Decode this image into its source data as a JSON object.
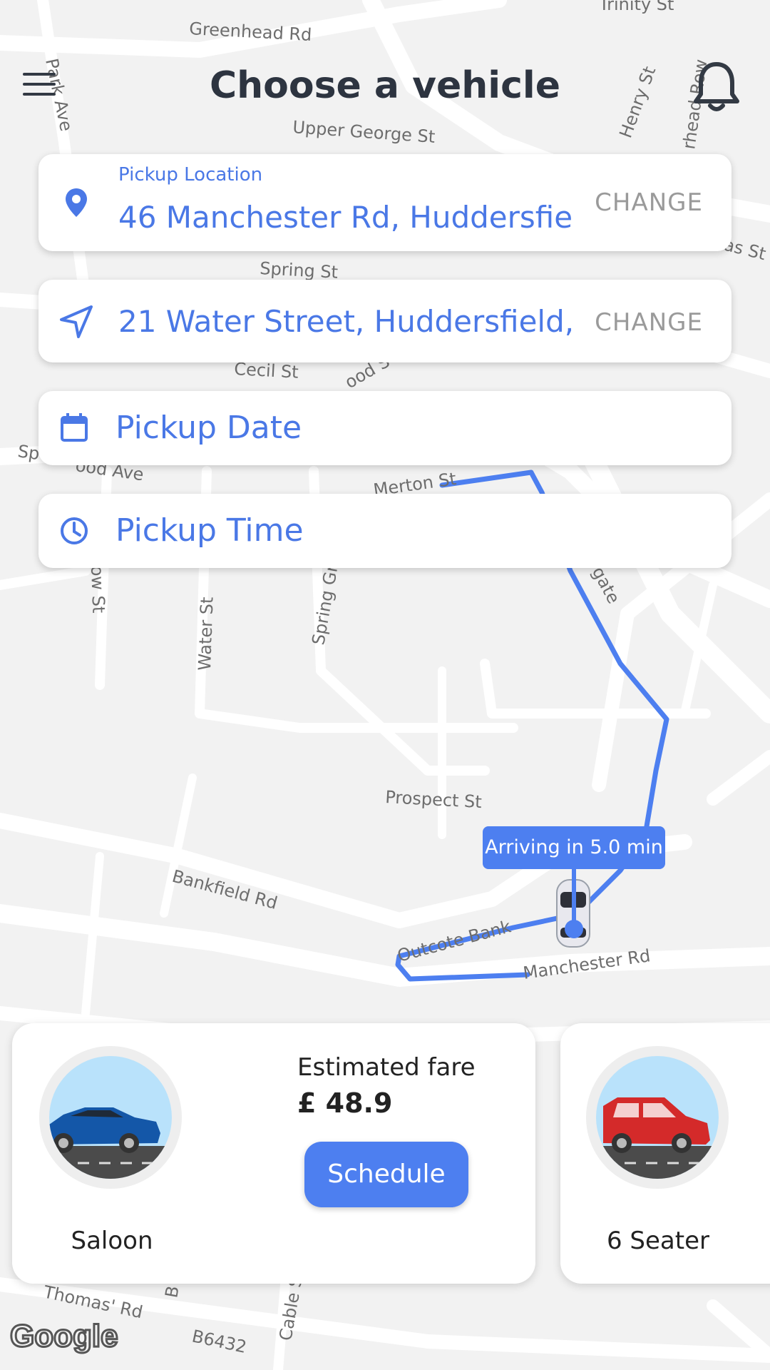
{
  "header": {
    "title": "Choose a vehicle",
    "menu_icon": "hamburger-menu-icon",
    "bell_icon": "bell-icon"
  },
  "pickup": {
    "label": "Pickup Location",
    "value": "46 Manchester Rd, Huddersfie",
    "change_label": "CHANGE"
  },
  "destination": {
    "value": "21 Water Street, Huddersfield,",
    "change_label": "CHANGE"
  },
  "pickup_date": {
    "placeholder": "Pickup Date"
  },
  "pickup_time": {
    "placeholder": "Pickup Time"
  },
  "map": {
    "streets": [
      "Greenhead Rd",
      "Trinity St",
      "Park Ave",
      "Upper George St",
      "Henry St",
      "rhead Row",
      "Spring St",
      "as St",
      "Cecil St",
      "ood S",
      "Sp",
      "ood Ave",
      "Merton St",
      "ow St",
      "Water St",
      "Spring Gr",
      "gate",
      "Prospect St",
      "Bankfield Rd",
      "Outcote Bank",
      "Manchester Rd",
      "Thomas' Rd",
      "B6432",
      "Cable St",
      "B"
    ],
    "eta_badge": "Arriving in 5.0 min",
    "attribution": "Google",
    "route_color": "#4d7ff0"
  },
  "vehicles": [
    {
      "name": "Saloon",
      "fare_label": "Estimated fare",
      "fare_value": "£ 48.9",
      "action_label": "Schedule"
    },
    {
      "name": "6 Seater"
    }
  ],
  "colors": {
    "accent": "#4a78e6",
    "button": "#4d7ff0",
    "muted": "#9a9a9a"
  }
}
